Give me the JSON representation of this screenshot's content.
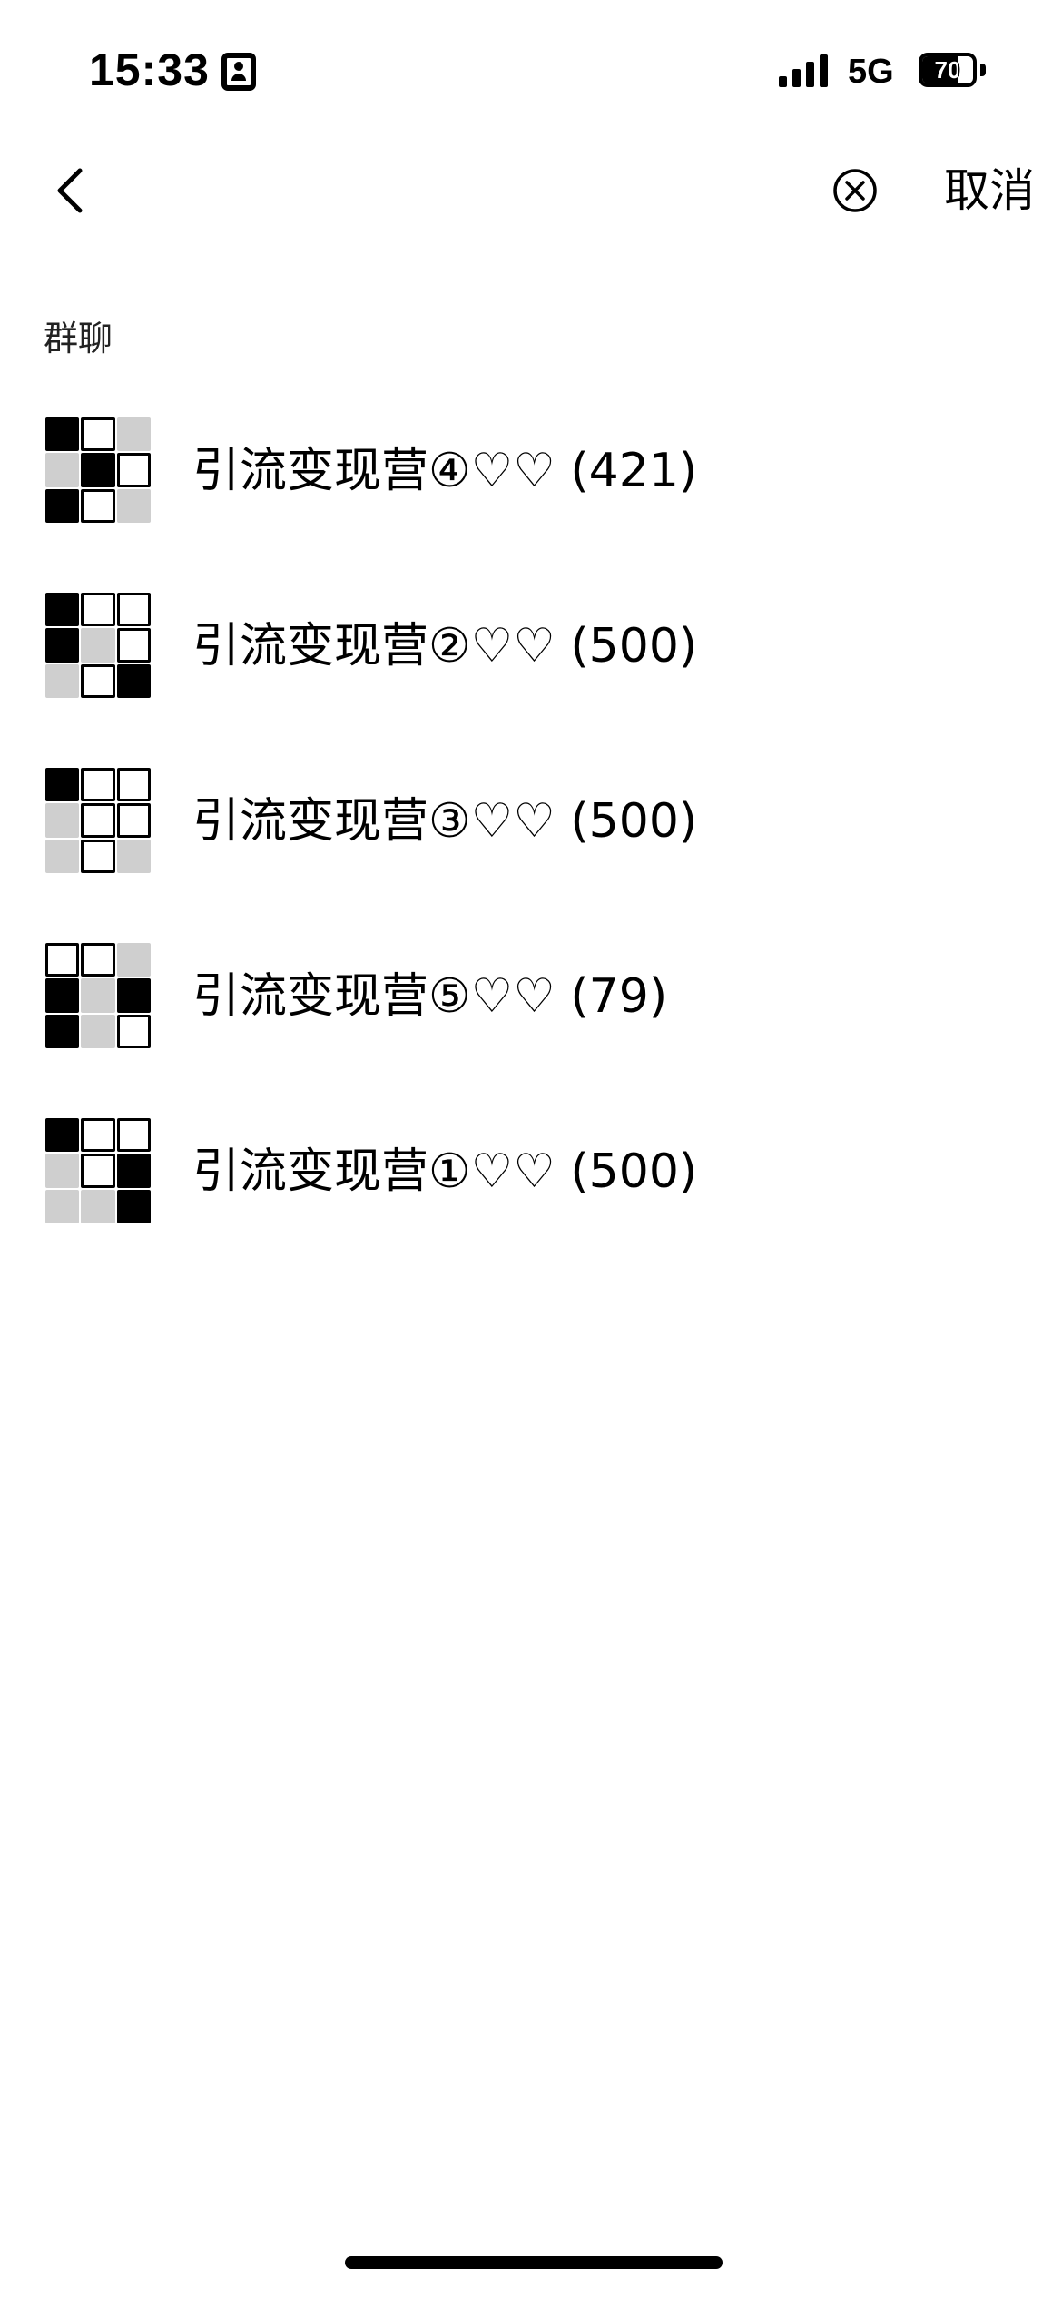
{
  "status_bar": {
    "time": "15:33",
    "network": "5G",
    "battery_level": "70",
    "icons": [
      "lock-icon",
      "signal-icon",
      "battery-icon"
    ]
  },
  "search": {
    "query": "",
    "cancel_label": "取消",
    "icons": [
      "back-icon",
      "clear-icon"
    ]
  },
  "section": {
    "title": "群聊"
  },
  "groups": [
    {
      "label": "引流变现营④♡♡ (421)"
    },
    {
      "label": "引流变现营②♡♡ (500)"
    },
    {
      "label": "引流变现营③♡♡ (500)"
    },
    {
      "label": "引流变现营⑤♡♡ (79)"
    },
    {
      "label": "引流变现营①♡♡ (500)"
    }
  ],
  "colors": {
    "background": "#ffffff",
    "text": "#000000"
  }
}
